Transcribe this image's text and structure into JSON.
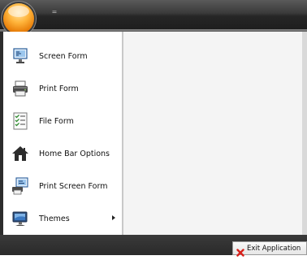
{
  "title_bar": {
    "quick_access_glyph": "="
  },
  "app_menu": {
    "items": [
      {
        "label": "Screen Form",
        "icon": "screen-form-icon"
      },
      {
        "label": "Print Form",
        "icon": "printer-icon"
      },
      {
        "label": "File Form",
        "icon": "checklist-icon"
      },
      {
        "label": "Home Bar Options",
        "icon": "home-icon"
      },
      {
        "label": "Print Screen Form",
        "icon": "print-screen-icon"
      },
      {
        "label": "Themes",
        "icon": "themes-monitor-icon",
        "has_submenu": true
      }
    ]
  },
  "footer": {
    "exit_label": "Exit Application"
  },
  "colors": {
    "title_bar": "#2a2a2a",
    "orb": "#f39a1f",
    "content_background": "#f4f4f4",
    "exit_icon": "#d8201a"
  }
}
